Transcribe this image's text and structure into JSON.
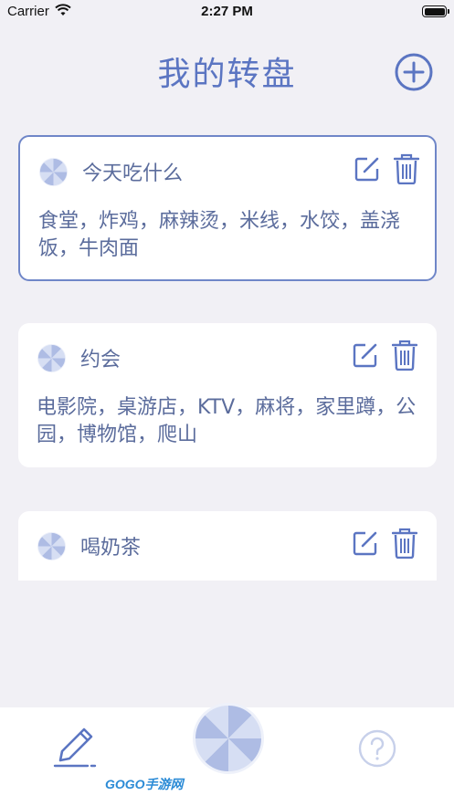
{
  "status_bar": {
    "carrier": "Carrier",
    "time": "2:27 PM"
  },
  "header": {
    "title": "我的转盘",
    "add_icon": "plus-circle-icon"
  },
  "wheels": [
    {
      "name": "今天吃什么",
      "options": "食堂，炸鸡，麻辣烫，米线，水饺，盖浇饭，牛肉面",
      "selected": true
    },
    {
      "name": "约会",
      "options": "电影院，桌游店，KTV，麻将，家里蹲，公园，博物馆，爬山",
      "selected": false
    },
    {
      "name": "喝奶茶",
      "options": "",
      "selected": false
    }
  ],
  "tab_bar": {
    "items": [
      "edit-pen-icon",
      "spin-wheel-icon",
      "help-icon"
    ]
  },
  "watermark": {
    "text": "GOGO手游网"
  },
  "colors": {
    "accent": "#5b75c2",
    "background": "#f1f0f5",
    "card": "#ffffff",
    "wheel_light": "#c9d3ee",
    "wheel_dark": "#aebce4"
  }
}
